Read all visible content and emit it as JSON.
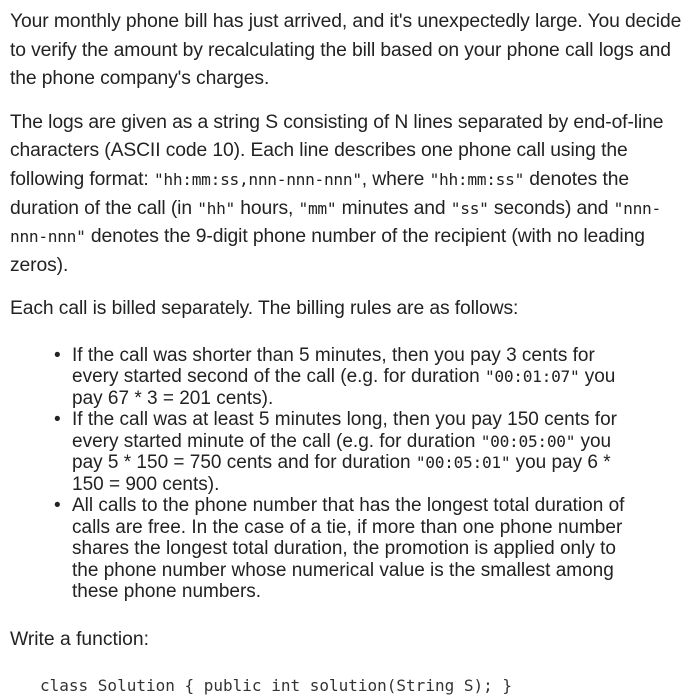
{
  "intro": {
    "p1": "Your monthly phone bill has just arrived, and it's unexpectedly large. You decide to verify the amount by recalculating the bill based on your phone call logs and the phone company's charges.",
    "p2_a": "The logs are given as a string S consisting of N lines separated by end-of-line characters (ASCII code 10). Each line describes one phone call using the following format: ",
    "p2_code1": "\"hh:mm:ss,nnn-nnn-nnn\"",
    "p2_b": ", where ",
    "p2_code2": "\"hh:mm:ss\"",
    "p2_c": " denotes the duration of the call (in ",
    "p2_code3": "\"hh\"",
    "p2_d": " hours, ",
    "p2_code4": "\"mm\"",
    "p2_e": " minutes and ",
    "p2_code5": "\"ss\"",
    "p2_f": " seconds) and ",
    "p2_code6": "\"nnn-nnn-nnn\"",
    "p2_g": " denotes the 9-digit phone number of the recipient (with no leading zeros).",
    "p3": "Each call is billed separately. The billing rules are as follows:"
  },
  "rules": {
    "r1_a": "If the call was shorter than 5 minutes, then you pay 3 cents for every started second of the call (e.g. for duration ",
    "r1_code": "\"00:01:07\"",
    "r1_b": " you pay 67 * 3 = 201 cents).",
    "r2_a": "If the call was at least 5 minutes long, then you pay 150 cents for every started minute of the call (e.g. for duration ",
    "r2_code1": "\"00:05:00\"",
    "r2_b": " you pay 5 * 150 = 750 cents and for duration ",
    "r2_code2": "\"00:05:01\"",
    "r2_c": " you pay 6 * 150 = 900 cents).",
    "r3": "All calls to the phone number that has the longest total duration of calls are free. In the case of a tie, if more than one phone number shares the longest total duration, the promotion is applied only to the phone number whose numerical value is the smallest among these phone numbers."
  },
  "outro": {
    "write": "Write a function:",
    "code_signature": "class Solution { public int solution(String S); }"
  }
}
